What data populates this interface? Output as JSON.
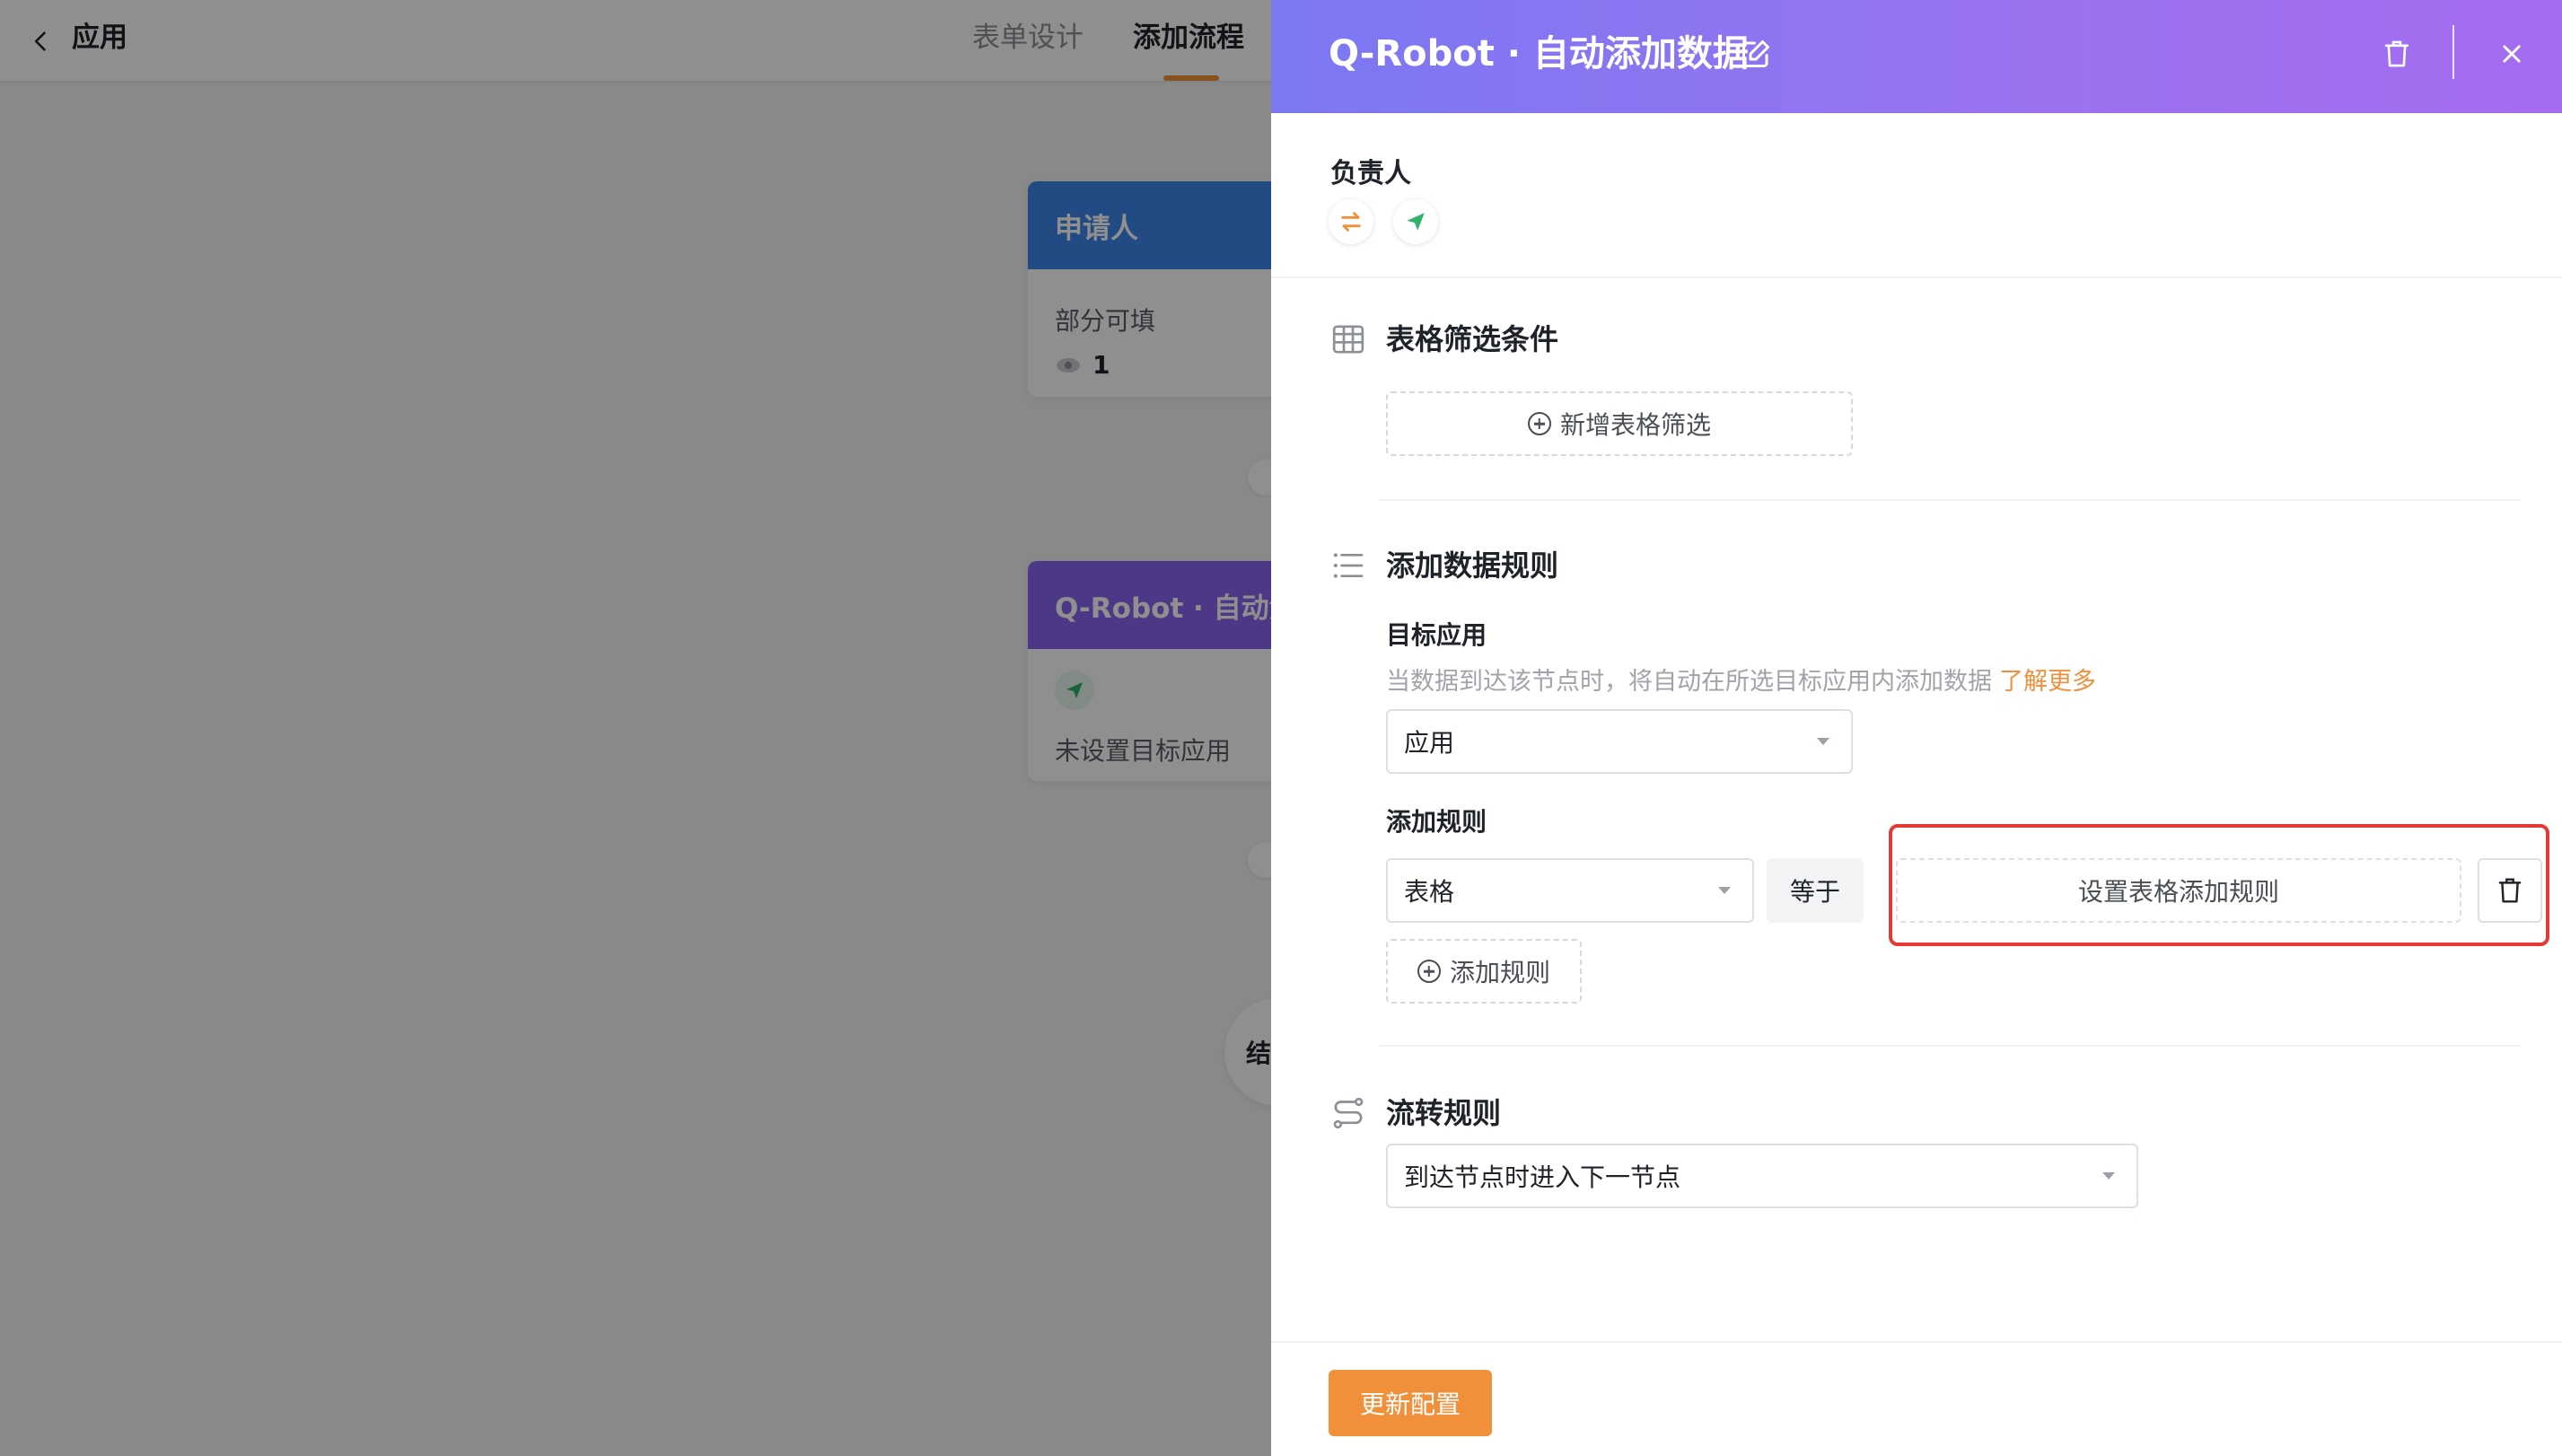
{
  "topbar": {
    "app_title": "应用",
    "tabs": [
      {
        "label": "表单设计",
        "active": false
      },
      {
        "label": "添加流程",
        "active": true
      }
    ]
  },
  "canvas": {
    "applicant_node": {
      "title": "申请人",
      "subtitle": "部分可填",
      "view_count": "1"
    },
    "robot_node": {
      "title": "Q-Robot · 自动添",
      "status": "未设置目标应用"
    },
    "end_node": {
      "label": "结"
    }
  },
  "drawer": {
    "title": "Q-Robot · 自动添加数据",
    "owner": {
      "label": "负责人"
    },
    "table_filter": {
      "title": "表格筛选条件",
      "add_button": "新增表格筛选"
    },
    "add_data_rules": {
      "title": "添加数据规则",
      "target_app": {
        "label": "目标应用",
        "hint": "当数据到达该节点时，将自动在所选目标应用内添加数据",
        "learn_more": "了解更多",
        "select_value": "应用"
      },
      "add_rules": {
        "label": "添加规则",
        "table_select_value": "表格",
        "operator": "等于",
        "set_rule_button": "设置表格添加规则",
        "add_rule_button": "添加规则"
      }
    },
    "flow_rules": {
      "title": "流转规则",
      "select_value": "到达节点时进入下一节点"
    },
    "update_button": "更新配置"
  },
  "colors": {
    "accent_orange": "#f0903a",
    "header_gradient_start": "#7b78f2",
    "header_gradient_end": "#a46cf0",
    "highlight_red": "#e53935",
    "applicant_blue": "#3d86ec",
    "robot_purple": "#8a62f0"
  },
  "icons": {
    "back": "chevron-left-icon",
    "edit": "edit-icon",
    "delete": "trash-icon",
    "close": "close-icon",
    "table": "table-icon",
    "list": "list-icon",
    "flow": "flow-icon",
    "swap": "swap-icon",
    "send": "send-icon",
    "eye": "eye-icon"
  }
}
